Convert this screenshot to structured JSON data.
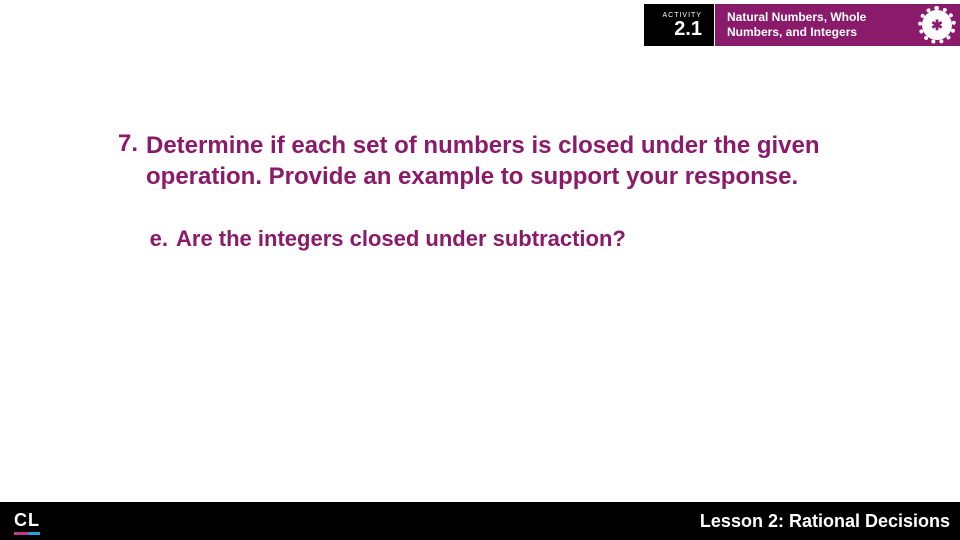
{
  "activity": {
    "label": "ACTIVITY",
    "number": "2.1",
    "title": "Natural Numbers, Whole Numbers, and Integers",
    "icon_glyph": "✱"
  },
  "question": {
    "number": "7.",
    "prompt": "Determine if each set of numbers is closed under the given operation. Provide an example to support your response.",
    "sub_letter": "e.",
    "sub_prompt": "Are the integers closed under subtraction?"
  },
  "footer": {
    "logo": "CL",
    "lesson": "Lesson 2: Rational Decisions"
  },
  "colors": {
    "accent": "#8a1a6a"
  }
}
